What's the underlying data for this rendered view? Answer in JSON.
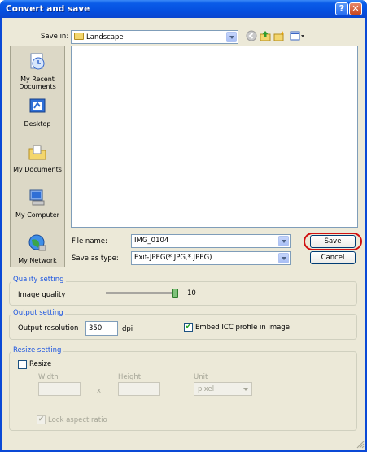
{
  "window": {
    "title": "Convert and save",
    "help_glyph": "?",
    "close_glyph": "✕"
  },
  "toolbar": {
    "save_in_label": "Save in:",
    "save_in_value": "Landscape"
  },
  "places": [
    {
      "label_line1": "My Recent",
      "label_line2": "Documents"
    },
    {
      "label_line1": "Desktop",
      "label_line2": ""
    },
    {
      "label_line1": "My Documents",
      "label_line2": ""
    },
    {
      "label_line1": "My Computer",
      "label_line2": ""
    },
    {
      "label_line1": "My Network",
      "label_line2": ""
    }
  ],
  "file": {
    "name_label": "File name:",
    "name_value": "IMG_0104",
    "type_label": "Save as type:",
    "type_value": "Exif-JPEG(*.JPG,*.JPEG)",
    "save_label": "Save",
    "cancel_label": "Cancel"
  },
  "quality": {
    "group_title": "Quality setting",
    "label": "Image quality",
    "value_text": "10",
    "value": 10,
    "max": 10
  },
  "output": {
    "group_title": "Output setting",
    "resolution_label": "Output resolution",
    "resolution_value": "350",
    "unit": "dpi",
    "embed_icc_label": "Embed ICC profile in image",
    "embed_icc_checked": true
  },
  "resize": {
    "group_title": "Resize setting",
    "resize_label": "Resize",
    "resize_checked": false,
    "width_label": "Width",
    "height_label": "Height",
    "x_glyph": "x",
    "unit_label": "Unit",
    "unit_value": "pixel",
    "lock_label": "Lock aspect ratio",
    "lock_checked": true
  }
}
